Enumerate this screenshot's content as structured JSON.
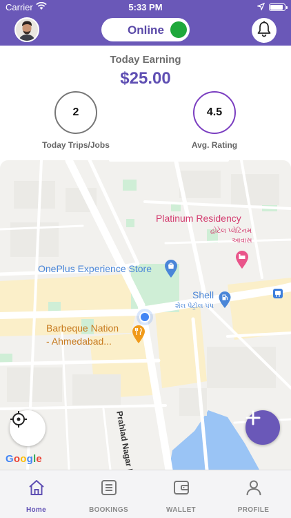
{
  "status_bar": {
    "carrier": "Carrier",
    "time": "5:33 PM",
    "battery_level": 0.95
  },
  "header": {
    "online_label": "Online",
    "online_color": "#1fa83b",
    "brand_color": "#6a58b8"
  },
  "earnings": {
    "title": "Today Earning",
    "amount": "$25.00",
    "trips_value": "2",
    "trips_label": "Today Trips/Jobs",
    "rating_value": "4.5",
    "rating_label": "Avg. Rating"
  },
  "map": {
    "labels": {
      "platinum": "Platinum Residency",
      "platinum_gu_1": "હોટેલ પ્લેટિનમ",
      "platinum_gu_2": "આવાસ",
      "oneplus": "OnePlus Experience Store",
      "shell": "Shell",
      "shell_gu": "શેલ પેટ્રોલ પંપ",
      "barbeque_1": "Barbeque Nation",
      "barbeque_2": "- Ahmedabad...",
      "road": "Prahlad Nagar Rd"
    },
    "google_letters": [
      "G",
      "o",
      "o",
      "g",
      "l",
      "e"
    ]
  },
  "bottom_nav": [
    {
      "label": "Home",
      "icon": "home-icon",
      "active": true
    },
    {
      "label": "BOOKINGS",
      "icon": "bookings-icon",
      "active": false
    },
    {
      "label": "WALLET",
      "icon": "wallet-icon",
      "active": false
    },
    {
      "label": "PROFILE",
      "icon": "profile-icon",
      "active": false
    }
  ]
}
